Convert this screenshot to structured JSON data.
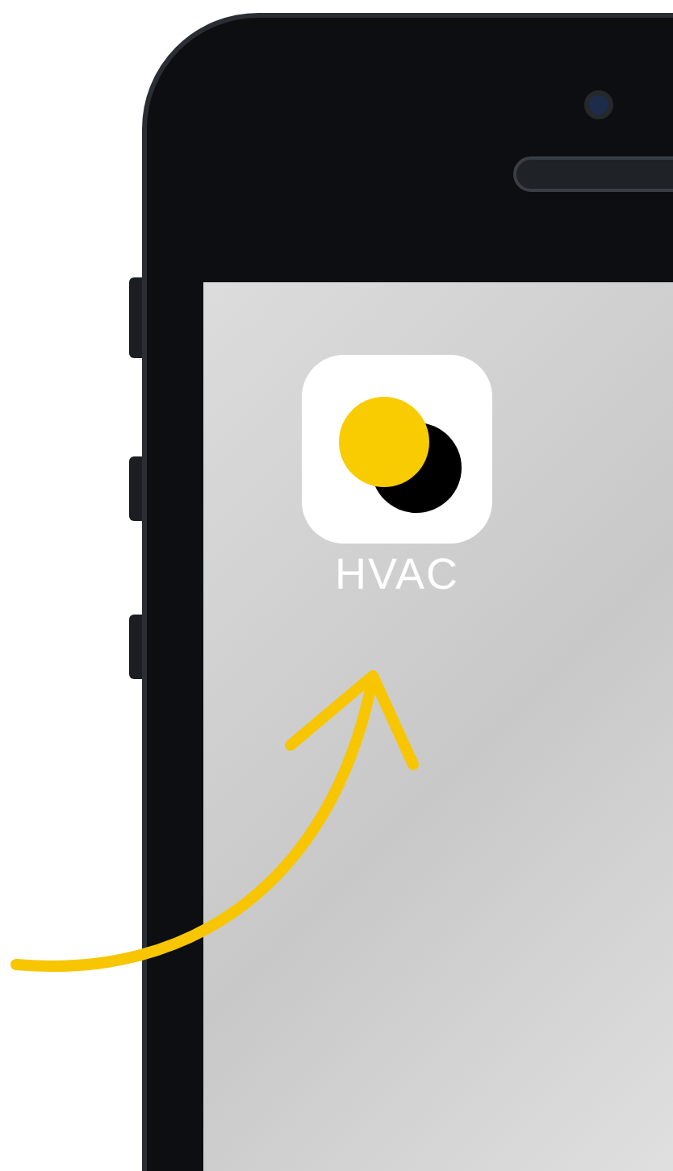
{
  "app_icon": {
    "label": "HVAC"
  }
}
